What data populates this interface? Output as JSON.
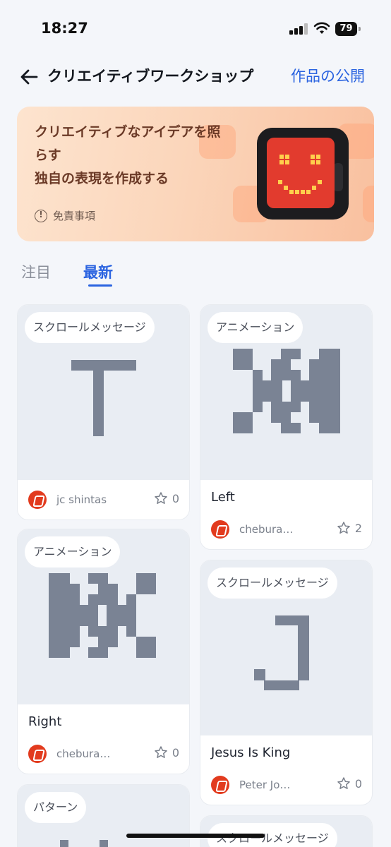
{
  "status_bar": {
    "time": "18:27",
    "battery": "79"
  },
  "nav": {
    "title": "クリエイティブワークショップ",
    "action": "作品の公開"
  },
  "banner": {
    "headline_line1": "クリエイティブなアイデアを照",
    "headline_line2": "らす",
    "headline_line3": "独自の表現を作成する",
    "disclaimer": "免責事項"
  },
  "tabs": [
    {
      "label": "注目",
      "active": false
    },
    {
      "label": "最新",
      "active": true
    }
  ],
  "cards": [
    {
      "tag": "スクロールメッセージ",
      "title": "",
      "author": "jc shintas",
      "stars": "0",
      "icon": "pixel-letter-T"
    },
    {
      "tag": "アニメーション",
      "title": "Left",
      "author": "chebura…",
      "stars": "2",
      "icon": "pixel-arrows-left"
    },
    {
      "tag": "アニメーション",
      "title": "Right",
      "author": "chebura…",
      "stars": "0",
      "icon": "pixel-arrows-right"
    },
    {
      "tag": "スクロールメッセージ",
      "title": "Jesus Is King",
      "author": "Peter Jo…",
      "stars": "0",
      "icon": "pixel-letter-J"
    },
    {
      "tag": "パターン",
      "title": "",
      "author": "",
      "stars": "",
      "icon": "pixel-pattern"
    },
    {
      "tag": "スクロールメッセージ",
      "title": "",
      "author": "",
      "stars": "",
      "icon": "pixel-scroll"
    }
  ],
  "colors": {
    "accent": "#2a63e0",
    "pixel": "#7a8394",
    "avatar": "#e23b1e"
  }
}
